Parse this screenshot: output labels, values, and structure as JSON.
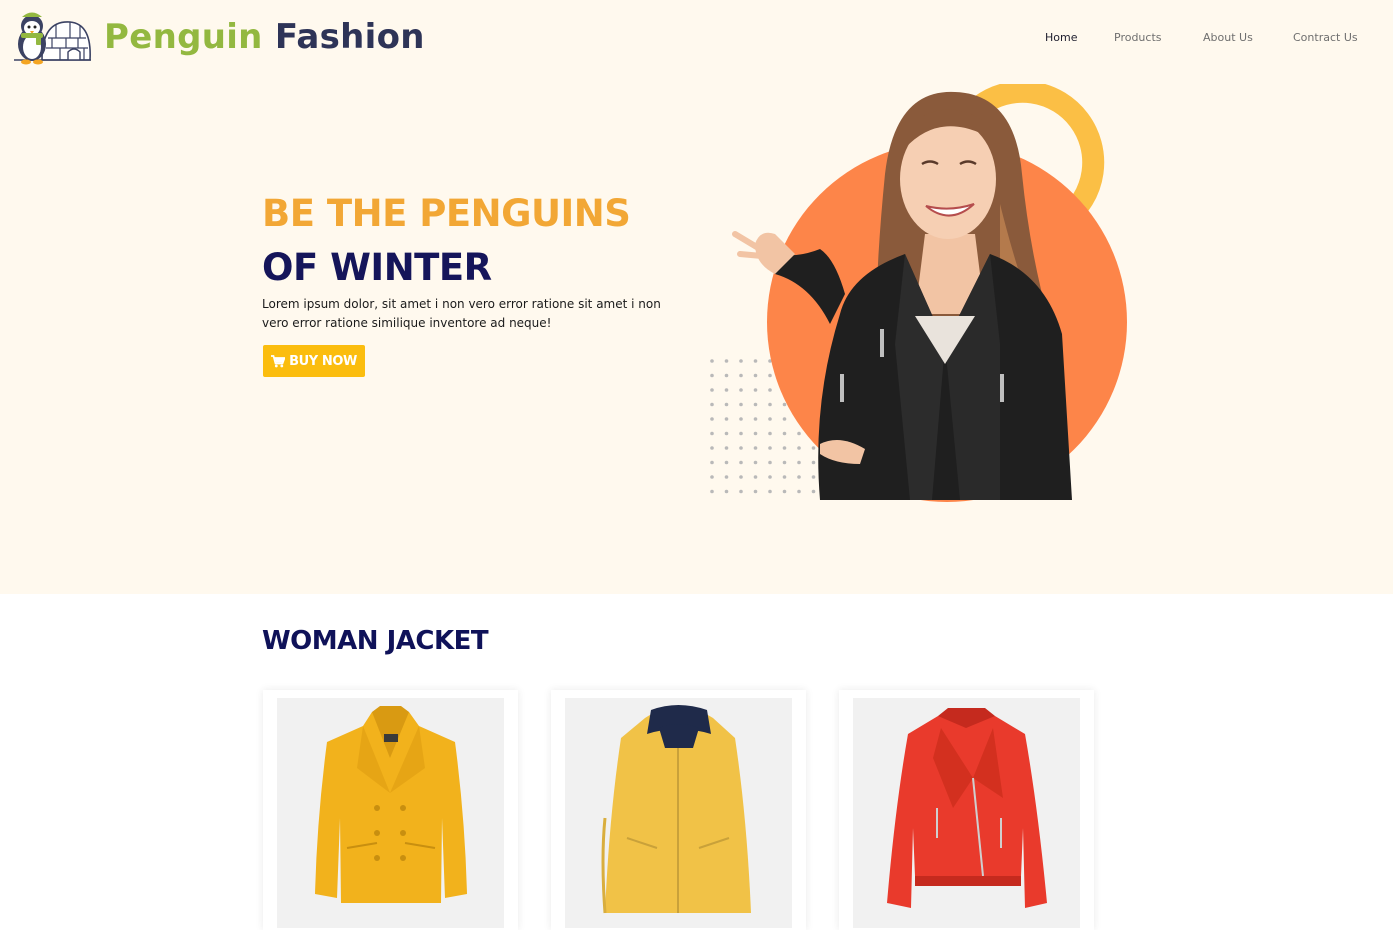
{
  "brand": {
    "part1": "Penguin",
    "part2": "Fashion",
    "logo_icon": "penguin-igloo-icon"
  },
  "nav": {
    "items": [
      {
        "label": "Home",
        "active": true
      },
      {
        "label": "Products",
        "active": false
      },
      {
        "label": "About Us",
        "active": false
      },
      {
        "label": "Contract Us",
        "active": false
      }
    ]
  },
  "hero": {
    "headline_line1": "BE THE PENGUINS",
    "headline_line2": "OF WINTER",
    "description": "Lorem ipsum dolor, sit amet i non vero error ratione sit amet i non vero error ratione similique inventore ad neque!",
    "cta_label": "BUY NOW",
    "cta_icon": "cart-icon",
    "colors": {
      "accent_orange": "#f2a735",
      "circle": "#fd8549",
      "ring": "#fbbf45",
      "button": "#fbbd0e",
      "navy": "#15155a"
    }
  },
  "products_section": {
    "title": "WOMAN JACKET",
    "items": [
      {
        "name": "mustard-peacoat-jacket",
        "color": "#f2b21c"
      },
      {
        "name": "yellow-hooded-raincoat",
        "color": "#f1c247"
      },
      {
        "name": "red-leather-biker-jacket",
        "color": "#e93a2c"
      }
    ]
  }
}
